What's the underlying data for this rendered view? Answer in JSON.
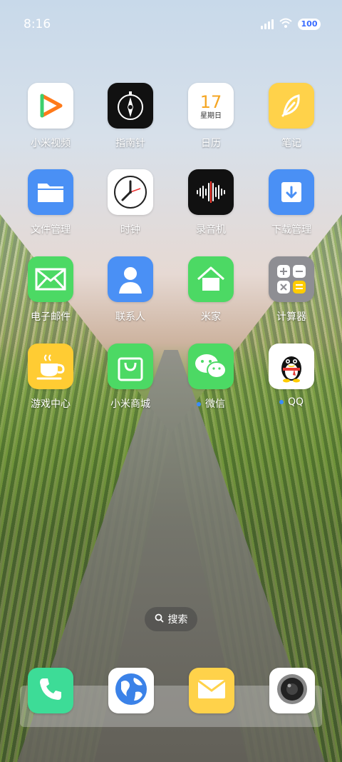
{
  "status_bar": {
    "time": "8:16",
    "battery": "100",
    "icons": [
      "signal-icon",
      "wifi-icon",
      "battery-icon"
    ]
  },
  "apps": [
    {
      "label": "小米视频",
      "icon": "play-icon",
      "color": "#ffffff"
    },
    {
      "label": "指南针",
      "icon": "compass-icon",
      "color": "#111111"
    },
    {
      "label": "日历",
      "icon": "calendar-icon",
      "color": "#ffffff",
      "day": "17",
      "weekday": "星期日"
    },
    {
      "label": "笔记",
      "icon": "feather-icon",
      "color": "#ffd24a"
    },
    {
      "label": "文件管理",
      "icon": "folder-icon",
      "color": "#4a90f5"
    },
    {
      "label": "时钟",
      "icon": "clock-icon",
      "color": "#ffffff"
    },
    {
      "label": "录音机",
      "icon": "waveform-icon",
      "color": "#111111"
    },
    {
      "label": "下载管理",
      "icon": "download-icon",
      "color": "#4a90f5"
    },
    {
      "label": "电子邮件",
      "icon": "mail-icon",
      "color": "#4cd964"
    },
    {
      "label": "联系人",
      "icon": "contact-icon",
      "color": "#4a90f5"
    },
    {
      "label": "米家",
      "icon": "home-icon",
      "color": "#4cd964"
    },
    {
      "label": "计算器",
      "icon": "calculator-icon",
      "color": "#8e8e93"
    },
    {
      "label": "游戏中心",
      "icon": "cup-icon",
      "color": "#ffcc33"
    },
    {
      "label": "小米商城",
      "icon": "shopping-bag-icon",
      "color": "#4cd964"
    },
    {
      "label": "微信",
      "icon": "wechat-icon",
      "color": "#4cd964",
      "badge_dot": true
    },
    {
      "label": "QQ",
      "icon": "qq-penguin-icon",
      "color": "#ffffff",
      "badge_dot": true
    }
  ],
  "search": {
    "label": "搜索"
  },
  "dock": [
    {
      "name": "phone",
      "icon": "phone-icon",
      "color": "#3ddc97"
    },
    {
      "name": "browser",
      "icon": "globe-icon",
      "color": "#ffffff"
    },
    {
      "name": "messages",
      "icon": "envelope-icon",
      "color": "#ffd24a"
    },
    {
      "name": "camera",
      "icon": "camera-icon",
      "color": "#ffffff"
    }
  ]
}
